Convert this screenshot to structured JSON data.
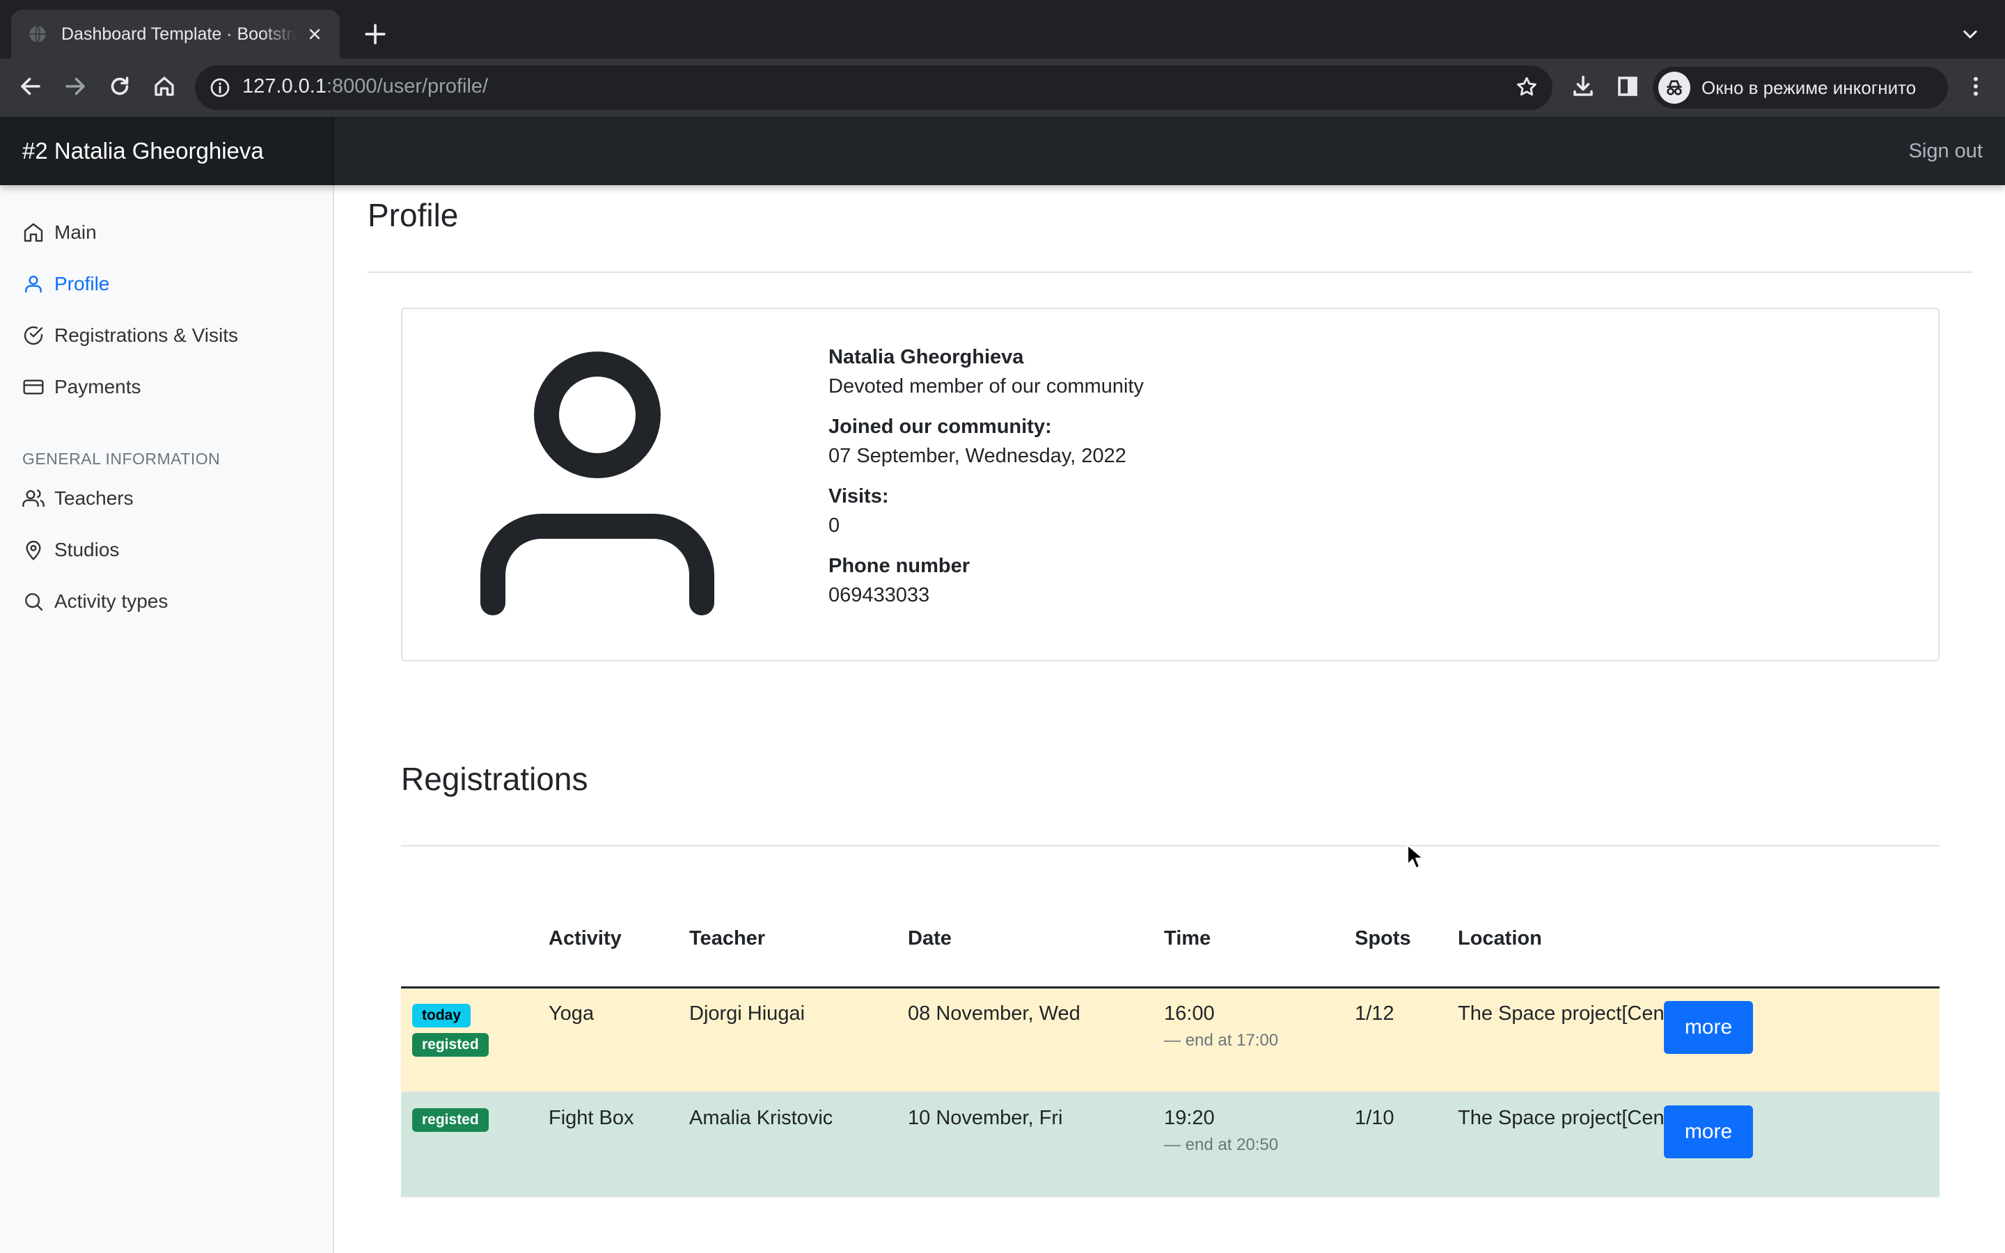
{
  "browser": {
    "tab_title": "Dashboard Template · Bootstrap",
    "url_host": "127.0.0.1",
    "url_rest": ":8000/user/profile/",
    "incognito_label": "Окно в режиме инкогнито"
  },
  "navbar": {
    "brand": "#2 Natalia Gheorghieva",
    "signout": "Sign out"
  },
  "sidebar": {
    "items": [
      {
        "label": "Main",
        "icon": "home-icon"
      },
      {
        "label": "Profile",
        "icon": "user-icon",
        "active": true
      },
      {
        "label": "Registrations & Visits",
        "icon": "check-circle-icon"
      },
      {
        "label": "Payments",
        "icon": "credit-card-icon"
      }
    ],
    "heading": "General information",
    "info_items": [
      {
        "label": "Teachers",
        "icon": "users-icon"
      },
      {
        "label": "Studios",
        "icon": "map-pin-icon"
      },
      {
        "label": "Activity types",
        "icon": "search-icon"
      }
    ]
  },
  "profile": {
    "page_title": "Profile",
    "name": "Natalia Gheorghieva",
    "tagline": "Devoted member of our community",
    "joined_label": "Joined our community:",
    "joined_value": "07 September, Wednesday, 2022",
    "visits_label": "Visits:",
    "visits_value": "0",
    "phone_label": "Phone number",
    "phone_value": "069433033"
  },
  "registrations": {
    "title": "Registrations",
    "columns": [
      "Activity",
      "Teacher",
      "Date",
      "Time",
      "Spots",
      "Location"
    ],
    "rows": [
      {
        "badges": [
          "today",
          "registed"
        ],
        "activity": "Yoga",
        "teacher": "Djorgi Hiugai",
        "date": "08 November, Wed",
        "time": "16:00",
        "end": "— end at 17:00",
        "spots": "1/12",
        "location": "The Space project[Center]",
        "button": "more",
        "status": "warning"
      },
      {
        "badges": [
          "registed"
        ],
        "activity": "Fight Box",
        "teacher": "Amalia Kristovic",
        "date": "10 November, Fri",
        "time": "19:20",
        "end": "— end at 20:50",
        "spots": "1/10",
        "location": "The Space project[Center]",
        "button": "more",
        "status": "success"
      }
    ]
  },
  "colors": {
    "accent": "#0d6efd",
    "navbar": "#212529",
    "warning_row": "#fff3cd",
    "success_row": "#d1e7dd"
  }
}
